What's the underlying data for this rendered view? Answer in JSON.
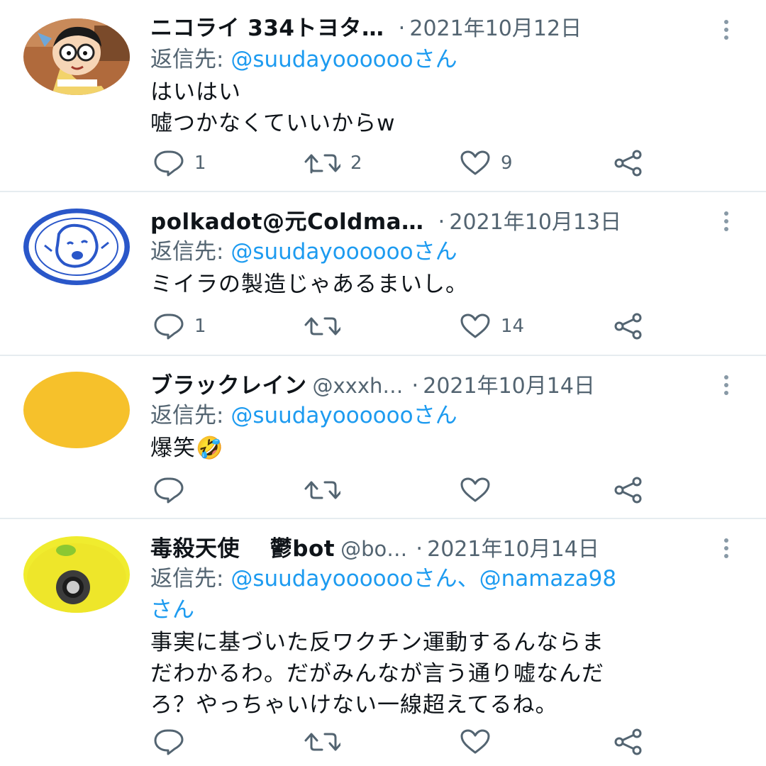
{
  "tweets": [
    {
      "name": "ニコライ 334トヨタ…",
      "handle": "",
      "separator": "·",
      "date": "2021年10月12日",
      "reply_label": "返信先: ",
      "reply_mentions": "@suudayoooooo",
      "reply_suffix": "さん",
      "text_lines": [
        "はいはい",
        "嘘つかなくていいからw"
      ],
      "reply_count": "1",
      "retweet_count": "2",
      "like_count": "9",
      "avatar": "cartoon-boy-avatar"
    },
    {
      "name": "polkadot@元Coldma…",
      "handle": "",
      "separator": "·",
      "date": "2021年10月13日",
      "reply_label": "返信先: ",
      "reply_mentions": "@suudayoooooo",
      "reply_suffix": "さん",
      "text_lines": [
        "ミイラの製造じゃあるまいし。"
      ],
      "reply_count": "1",
      "retweet_count": "",
      "like_count": "14",
      "avatar": "blue-stamp-avatar"
    },
    {
      "name": "ブラックレイン",
      "handle": "@xxxh…",
      "separator": "·",
      "date": "2021年10月14日",
      "reply_label": "返信先: ",
      "reply_mentions": "@suudayoooooo",
      "reply_suffix": "さん",
      "text_lines": [
        "爆笑🤣"
      ],
      "reply_count": "",
      "retweet_count": "",
      "like_count": "",
      "avatar": "yellow-circle-avatar"
    },
    {
      "name": "毒殺天使　 鬱bot",
      "handle": "@bo…",
      "separator": "·",
      "date": "2021年10月14日",
      "reply_label": "返信先: ",
      "reply_mentions": "@suudayoooooo",
      "reply_suffix": "さん、",
      "reply_mentions_2": "@namaza98",
      "reply_suffix_2": "さん",
      "text_lines": [
        "事実に基づいた反ワクチン運動するんならま",
        "だわかるわ。だがみんなが言う通り嘘なんだ",
        "ろ？やっちゃいけない一線超えてるね。"
      ],
      "reply_count": "",
      "retweet_count": "",
      "like_count": "",
      "avatar": "yellow-eye-avatar"
    }
  ],
  "colors": {
    "text": "#0f1419",
    "secondary": "#536471",
    "link": "#1d9bf0",
    "divider": "#e6ecf0",
    "icon": "#536471"
  }
}
